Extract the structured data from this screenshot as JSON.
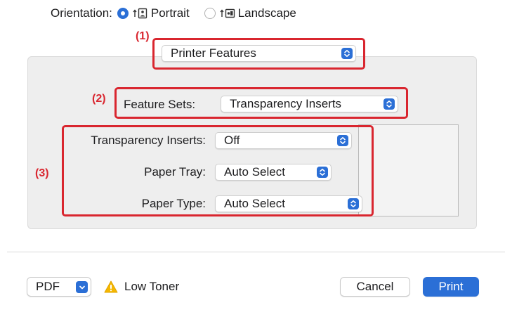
{
  "orientation": {
    "label": "Orientation:",
    "selected": "portrait",
    "options": [
      {
        "id": "portrait",
        "label": "Portrait"
      },
      {
        "id": "landscape",
        "label": "Landscape"
      }
    ]
  },
  "callouts": {
    "one": "(1)",
    "two": "(2)",
    "three": "(3)"
  },
  "section_popup": {
    "value": "Printer Features"
  },
  "feature_sets": {
    "label": "Feature Sets:",
    "value": "Transparency Inserts"
  },
  "settings": [
    {
      "label": "Transparency Inserts:",
      "value": "Off"
    },
    {
      "label": "Paper Tray:",
      "value": "Auto Select"
    },
    {
      "label": "Paper Type:",
      "value": "Auto Select"
    }
  ],
  "footer": {
    "pdf_label": "PDF",
    "warning_text": "Low Toner",
    "cancel_label": "Cancel",
    "print_label": "Print"
  },
  "colors": {
    "accent": "#2b6fd6",
    "callout": "#d9262f",
    "warning": "#f5b700"
  }
}
